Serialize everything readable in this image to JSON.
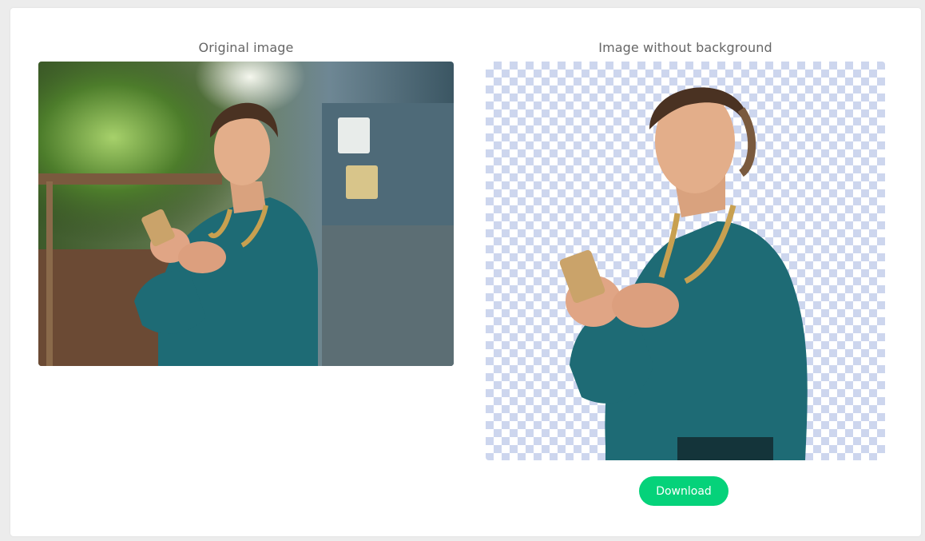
{
  "original": {
    "title": "Original image"
  },
  "result": {
    "title": "Image without background"
  },
  "actions": {
    "download_label": "Download"
  },
  "colors": {
    "accent": "#05d27a",
    "checker": "#cdd6ee",
    "title_text": "#666666"
  }
}
